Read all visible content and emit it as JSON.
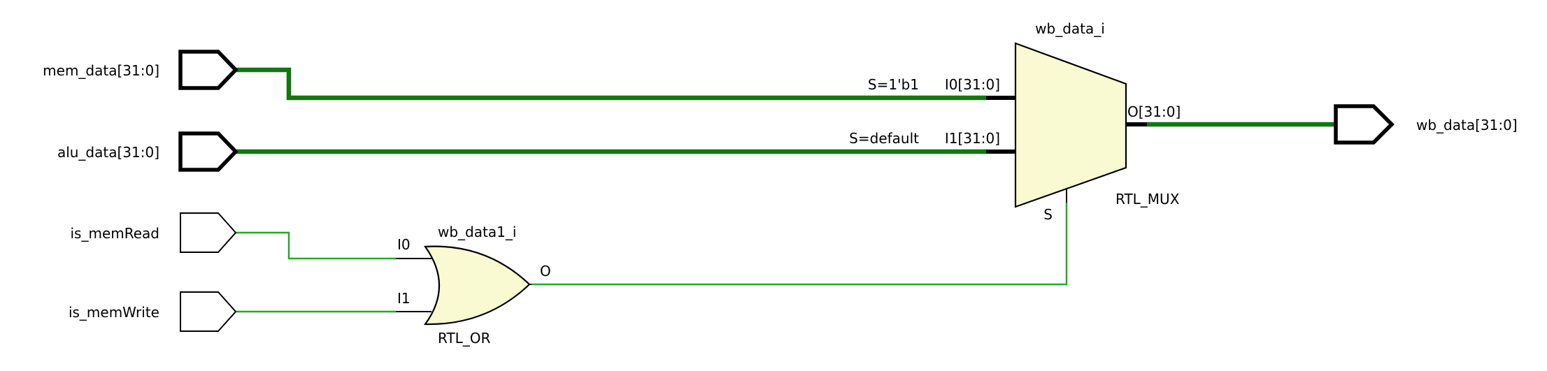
{
  "ports": {
    "mem_data": "mem_data[31:0]",
    "alu_data": "alu_data[31:0]",
    "is_memRead": "is_memRead",
    "is_memWrite": "is_memWrite",
    "wb_data": "wb_data[31:0]"
  },
  "mux": {
    "instance": "wb_data_i",
    "type": "RTL_MUX",
    "in0": "I0[31:0]",
    "in0_sel": "S=1'b1",
    "in1": "I1[31:0]",
    "in1_sel": "S=default",
    "out": "O[31:0]",
    "sel": "S"
  },
  "or_gate": {
    "instance": "wb_data1_i",
    "type": "RTL_OR",
    "in0": "I0",
    "in1": "I1",
    "out": "O"
  },
  "colors": {
    "bus": "#117711",
    "wire": "#22aa22",
    "cell_fill": "#fafad2"
  }
}
